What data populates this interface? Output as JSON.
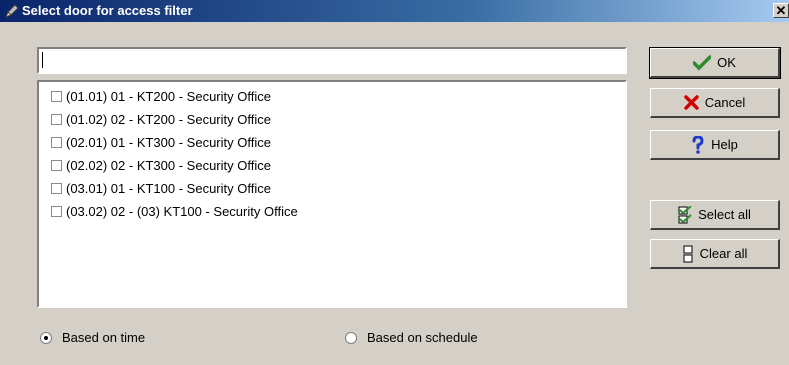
{
  "window": {
    "title": "Select door for access filter",
    "close_glyph": "✕",
    "title_icon": "pen-icon"
  },
  "filter": {
    "value": "",
    "placeholder": ""
  },
  "doors": [
    {
      "label": "(01.01) 01 - KT200 - Security Office",
      "checked": false
    },
    {
      "label": "(01.02) 02 - KT200 - Security Office",
      "checked": false
    },
    {
      "label": "(02.01) 01 - KT300 - Security Office",
      "checked": false
    },
    {
      "label": "(02.02) 02 - KT300 - Security Office",
      "checked": false
    },
    {
      "label": "(03.01) 01 - KT100 - Security Office",
      "checked": false
    },
    {
      "label": "(03.02) 02 - (03) KT100 - Security Office",
      "checked": false
    }
  ],
  "buttons": {
    "ok": {
      "label": "OK",
      "icon": "checkmark-icon",
      "color": "#2e8b2e"
    },
    "cancel": {
      "label": "Cancel",
      "icon": "red-x-icon",
      "color": "#d40000"
    },
    "help": {
      "label": "Help",
      "icon": "question-icon",
      "color": "#1a3cc8"
    },
    "select_all": {
      "label": "Select all",
      "icon": "select-all-icon"
    },
    "clear_all": {
      "label": "Clear all",
      "icon": "clear-all-icon"
    }
  },
  "mode": {
    "options": [
      {
        "label": "Based on time",
        "selected": true
      },
      {
        "label": "Based on schedule",
        "selected": false
      }
    ]
  }
}
